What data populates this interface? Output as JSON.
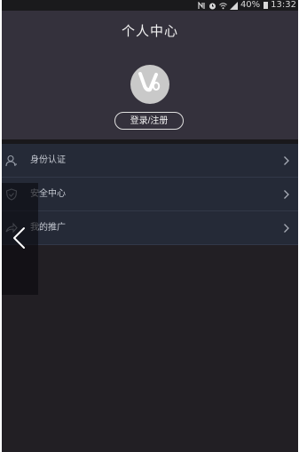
{
  "status_bar": {
    "battery_percent": "40%",
    "time": "13:32",
    "icons": [
      "nfc-icon",
      "alarm-icon",
      "wifi-icon",
      "signal-icon",
      "battery-icon"
    ]
  },
  "header": {
    "title": "个人中心",
    "avatar_icon": "uo-logo-icon",
    "login_button_label": "登录/注册"
  },
  "menu": {
    "items": [
      {
        "icon": "person-icon",
        "label": "身份认证"
      },
      {
        "icon": "shield-icon",
        "label": "安全中心"
      },
      {
        "icon": "share-icon",
        "label": "我的推广"
      }
    ]
  },
  "overlay": {
    "icon": "back-arrow-icon"
  },
  "colors": {
    "screen_bg": "#221f24",
    "header_bg": "#34313c",
    "menu_bg": "#252a37",
    "text_primary": "#f2f2f2",
    "text_menu": "#c8ccd4"
  }
}
